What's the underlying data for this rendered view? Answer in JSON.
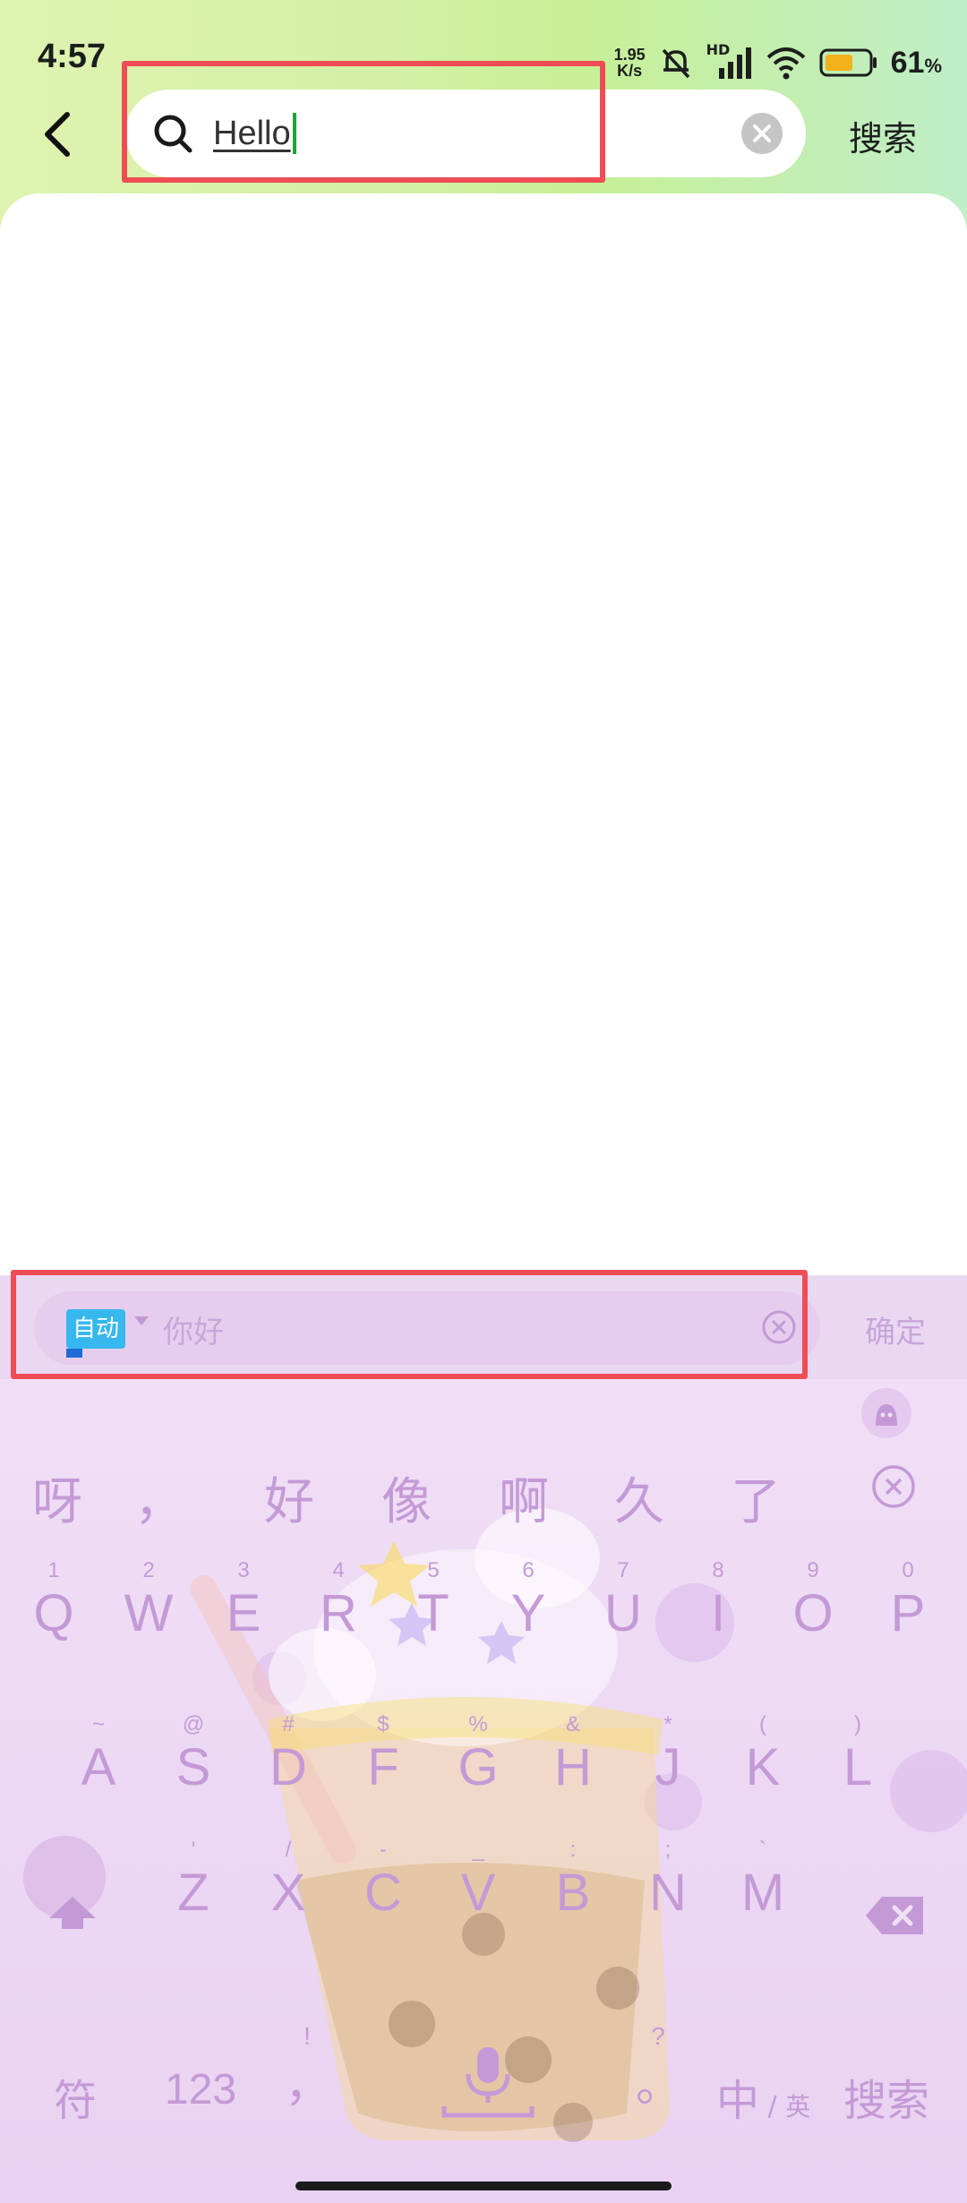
{
  "status_bar": {
    "time": "4:57",
    "net_speed_value": "1.95",
    "net_speed_unit": "K/s",
    "network_label": "HD",
    "battery_percent": "61",
    "battery_unit": "%"
  },
  "search": {
    "query": "Hello",
    "action_label": "搜索"
  },
  "ime": {
    "mode_label": "自动",
    "composition_text": "你好",
    "confirm_label": "确定"
  },
  "candidates": [
    "呀",
    "，",
    "好",
    "像",
    "啊",
    "久",
    "了"
  ],
  "keyboard": {
    "row1": [
      {
        "main": "Q",
        "sub": "1"
      },
      {
        "main": "W",
        "sub": "2"
      },
      {
        "main": "E",
        "sub": "3"
      },
      {
        "main": "R",
        "sub": "4"
      },
      {
        "main": "T",
        "sub": "5"
      },
      {
        "main": "Y",
        "sub": "6"
      },
      {
        "main": "U",
        "sub": "7"
      },
      {
        "main": "I",
        "sub": "8"
      },
      {
        "main": "O",
        "sub": "9"
      },
      {
        "main": "P",
        "sub": "0"
      }
    ],
    "row2": [
      {
        "main": "A",
        "sub": "~"
      },
      {
        "main": "S",
        "sub": "@"
      },
      {
        "main": "D",
        "sub": "#"
      },
      {
        "main": "F",
        "sub": "$"
      },
      {
        "main": "G",
        "sub": "%"
      },
      {
        "main": "H",
        "sub": "&"
      },
      {
        "main": "J",
        "sub": "*"
      },
      {
        "main": "K",
        "sub": "("
      },
      {
        "main": "L",
        "sub": ")"
      }
    ],
    "row3": [
      {
        "main": "Z",
        "sub": "'"
      },
      {
        "main": "X",
        "sub": "/"
      },
      {
        "main": "C",
        "sub": "-"
      },
      {
        "main": "V",
        "sub": "_"
      },
      {
        "main": "B",
        "sub": ":"
      },
      {
        "main": "N",
        "sub": ";"
      },
      {
        "main": "M",
        "sub": "`"
      }
    ],
    "symbols_label": "符",
    "numbers_label": "123",
    "comma_label": "，",
    "comma_sub": "!",
    "period_label": "。",
    "period_sub": "?",
    "lang_main": "中",
    "lang_sub": "英",
    "search_label": "搜索"
  },
  "colors": {
    "accent_red": "#ef4d55",
    "keyboard_text": "#c49ad6",
    "caret_green": "#1fa23a"
  }
}
